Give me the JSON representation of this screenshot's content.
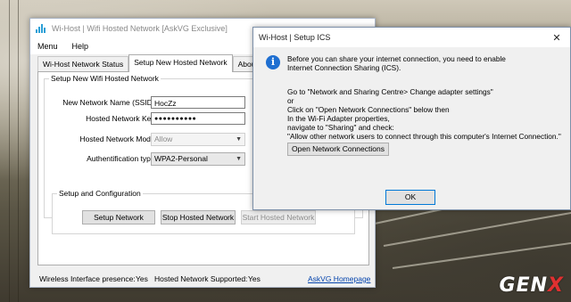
{
  "main_window": {
    "title": "Wi-Host | Wifi Hosted Network [AskVG Exclusive]",
    "controls": {
      "minimize": "—",
      "maximize": "☐",
      "close": "✕"
    },
    "menu": [
      "Menu",
      "Help"
    ],
    "tabs": [
      "Wi-Host Network Status",
      "Setup New Hosted Network",
      "About Wi-H"
    ],
    "active_tab": "Setup New Hosted Network",
    "setup_group": {
      "label": "Setup New Wifi Hosted Network",
      "ssid_label": "New Network Name (SSID):",
      "ssid_value": "HocZz",
      "key_label": "Hosted Network Key:",
      "key_value": "●●●●●●●●●●",
      "mode_label": "Hosted Network Mode:",
      "mode_value": "Allow",
      "auth_label": "Authentification type:",
      "auth_value": "WPA2-Personal"
    },
    "config_group": {
      "label": "Setup and Configuration",
      "setup_network": "Setup Network",
      "stop_hosted": "Stop Hosted Network",
      "start_hosted": "Start Hosted Network"
    },
    "status": {
      "wireless_label": "Wireless Interface presence:",
      "wireless_value": "Yes",
      "supported_label": "Hosted Network Supported:",
      "supported_value": "Yes",
      "homepage_link": "AskVG Homepage"
    }
  },
  "dialog": {
    "title": "Wi-Host | Setup ICS",
    "close": "✕",
    "icon": "info-icon",
    "lines": [
      "Before you can share your internet connection, you need to enable",
      "Internet Connection Sharing (ICS).",
      "Go to \"Network and Sharing Centre> Change adapter settings\"",
      "or",
      "Click on \"Open Network Connections\" below then",
      "In the Wi-Fi Adapter properties,",
      "navigate to \"Sharing\" and check:",
      "\"Allow other network users to connect through this computer's Internet Connection.\""
    ],
    "open_connections_button": "Open Network Connections",
    "ok_button": "OK"
  },
  "watermark": {
    "text_a": "GEN",
    "text_b": "X"
  },
  "colors": {
    "accent": "#0078d7",
    "link": "#0645ad",
    "info_icon": "#1f6fd1",
    "watermark_x": "#e03030"
  }
}
